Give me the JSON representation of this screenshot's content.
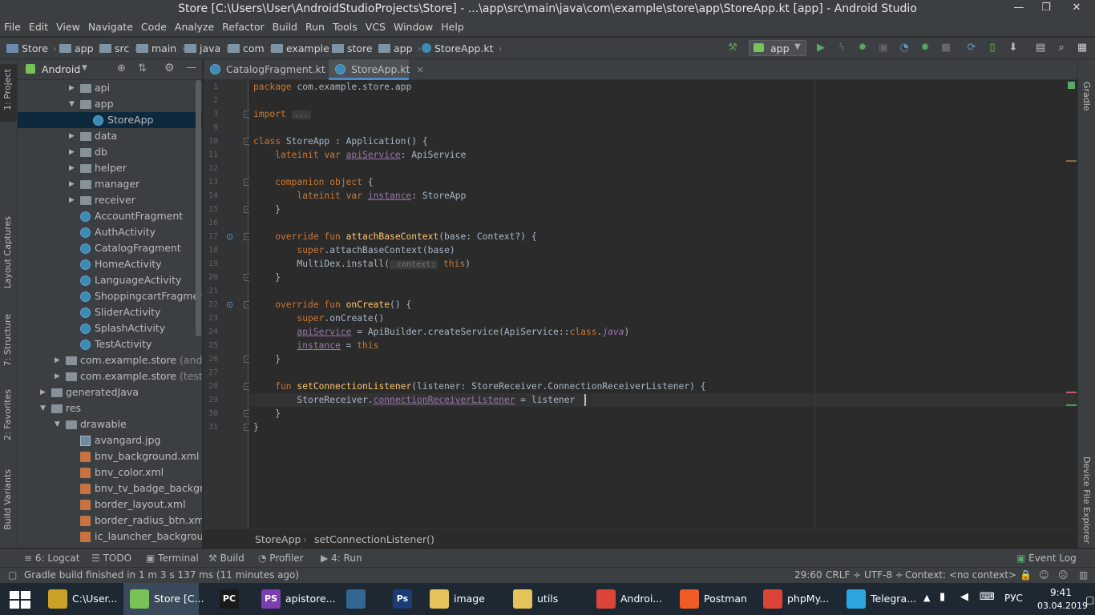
{
  "window": {
    "title": "Store [C:\\Users\\User\\AndroidStudioProjects\\Store] - ...\\app\\src\\main\\java\\com\\example\\store\\app\\StoreApp.kt [app] - Android Studio",
    "minimize": "—",
    "maximize": "❐",
    "close": "✕"
  },
  "menu": [
    "File",
    "Edit",
    "View",
    "Navigate",
    "Code",
    "Analyze",
    "Refactor",
    "Build",
    "Run",
    "Tools",
    "VCS",
    "Window",
    "Help"
  ],
  "breadcrumb": [
    "Store",
    "app",
    "src",
    "main",
    "java",
    "com",
    "example",
    "store",
    "app",
    "StoreApp.kt"
  ],
  "toolbar": {
    "run_config": "app"
  },
  "left_tool_windows": [
    "1: Project",
    "Layout Captures",
    "7: Structure",
    "2: Favorites",
    "Build Variants"
  ],
  "right_tool_windows": [
    "Gradle",
    "Device File Explorer"
  ],
  "project_panel": {
    "view": "Android",
    "rows": [
      {
        "label": "api",
        "type": "folder",
        "level": 3,
        "arrow": "right"
      },
      {
        "label": "app",
        "type": "folder",
        "level": 3,
        "arrow": "down"
      },
      {
        "label": "StoreApp",
        "type": "class",
        "level": 4,
        "selected": true
      },
      {
        "label": "data",
        "type": "folder",
        "level": 3,
        "arrow": "right"
      },
      {
        "label": "db",
        "type": "folder",
        "level": 3,
        "arrow": "right"
      },
      {
        "label": "helper",
        "type": "folder",
        "level": 3,
        "arrow": "right"
      },
      {
        "label": "manager",
        "type": "folder",
        "level": 3,
        "arrow": "right"
      },
      {
        "label": "receiver",
        "type": "folder",
        "level": 3,
        "arrow": "right"
      },
      {
        "label": "AccountFragment",
        "type": "class",
        "level": 3
      },
      {
        "label": "AuthActivity",
        "type": "class",
        "level": 3
      },
      {
        "label": "CatalogFragment",
        "type": "class",
        "level": 3
      },
      {
        "label": "HomeActivity",
        "type": "class",
        "level": 3
      },
      {
        "label": "LanguageActivity",
        "type": "class",
        "level": 3
      },
      {
        "label": "ShoppingcartFragment",
        "type": "class",
        "level": 3
      },
      {
        "label": "SliderActivity",
        "type": "class",
        "level": 3
      },
      {
        "label": "SplashActivity",
        "type": "class",
        "level": 3
      },
      {
        "label": "TestActivity",
        "type": "class",
        "level": 3
      },
      {
        "label": "com.example.store",
        "suffix": "(androidT",
        "type": "folder",
        "level": 2,
        "arrow": "right"
      },
      {
        "label": "com.example.store",
        "suffix": "(test)",
        "type": "folder",
        "level": 2,
        "arrow": "right"
      },
      {
        "label": "generatedJava",
        "type": "folder",
        "level": 1,
        "arrow": "right"
      },
      {
        "label": "res",
        "type": "folder",
        "level": 1,
        "arrow": "down"
      },
      {
        "label": "drawable",
        "type": "folder",
        "level": 2,
        "arrow": "down"
      },
      {
        "label": "avangard.jpg",
        "type": "img",
        "level": 3
      },
      {
        "label": "bnv_background.xml",
        "type": "xml",
        "level": 3
      },
      {
        "label": "bnv_color.xml",
        "type": "xml",
        "level": 3
      },
      {
        "label": "bnv_tv_badge_background",
        "type": "xml",
        "level": 3
      },
      {
        "label": "border_layout.xml",
        "type": "xml",
        "level": 3
      },
      {
        "label": "border_radius_btn.xml",
        "type": "xml",
        "level": 3
      },
      {
        "label": "ic_launcher_background.x",
        "type": "xml",
        "level": 3
      }
    ]
  },
  "editor_tabs": [
    {
      "label": "CatalogFragment.kt",
      "active": false,
      "close": "✕"
    },
    {
      "label": "StoreApp.kt",
      "active": true,
      "close": "✕"
    }
  ],
  "code": {
    "line_numbers": [
      "1",
      "2",
      "3",
      "9",
      "10",
      "11",
      "12",
      "13",
      "14",
      "15",
      "16",
      "17",
      "18",
      "19",
      "20",
      "21",
      "22",
      "23",
      "24",
      "25",
      "26",
      "27",
      "28",
      "29",
      "30",
      "31"
    ],
    "lines": [
      [
        {
          "t": "package ",
          "c": "kw"
        },
        {
          "t": "com.example.store.app",
          "c": ""
        }
      ],
      [],
      [
        {
          "t": "import ",
          "c": "kw"
        },
        {
          "t": "...",
          "c": "hint"
        }
      ],
      [],
      [
        {
          "t": "class ",
          "c": "kw"
        },
        {
          "t": "StoreApp : Application() {",
          "c": ""
        }
      ],
      [
        {
          "t": "    lateinit var ",
          "c": "kw"
        },
        {
          "t": "apiService",
          "c": "pr"
        },
        {
          "t": ": ApiService",
          "c": ""
        }
      ],
      [],
      [
        {
          "t": "    companion object ",
          "c": "kw"
        },
        {
          "t": "{",
          "c": ""
        }
      ],
      [
        {
          "t": "        lateinit var ",
          "c": "kw"
        },
        {
          "t": "instance",
          "c": "pr"
        },
        {
          "t": ": StoreApp",
          "c": ""
        }
      ],
      [
        {
          "t": "    }",
          "c": ""
        }
      ],
      [],
      [
        {
          "t": "    override fun ",
          "c": "kw"
        },
        {
          "t": "attachBaseContext",
          "c": "fn"
        },
        {
          "t": "(base: Context?) {",
          "c": ""
        }
      ],
      [
        {
          "t": "        ",
          "c": ""
        },
        {
          "t": "super",
          "c": "kw"
        },
        {
          "t": ".attachBaseContext(base)",
          "c": ""
        }
      ],
      [
        {
          "t": "        MultiDex.install(",
          "c": ""
        },
        {
          "t": " context:",
          "c": "hint"
        },
        {
          "t": " ",
          "c": ""
        },
        {
          "t": "this",
          "c": "kw"
        },
        {
          "t": ")",
          "c": ""
        }
      ],
      [
        {
          "t": "    }",
          "c": ""
        }
      ],
      [],
      [
        {
          "t": "    override fun ",
          "c": "kw"
        },
        {
          "t": "onCreate",
          "c": "fn"
        },
        {
          "t": "() {",
          "c": ""
        }
      ],
      [
        {
          "t": "        ",
          "c": ""
        },
        {
          "t": "super",
          "c": "kw"
        },
        {
          "t": ".onCreate()",
          "c": ""
        }
      ],
      [
        {
          "t": "        ",
          "c": ""
        },
        {
          "t": "apiService",
          "c": "pr"
        },
        {
          "t": " = ApiBuilder.createService(ApiService::",
          "c": ""
        },
        {
          "t": "class",
          "c": "kw"
        },
        {
          "t": ".",
          "c": ""
        },
        {
          "t": "java",
          "c": "it"
        },
        {
          "t": ")",
          "c": ""
        }
      ],
      [
        {
          "t": "        ",
          "c": ""
        },
        {
          "t": "instance",
          "c": "pr"
        },
        {
          "t": " = ",
          "c": ""
        },
        {
          "t": "this",
          "c": "kw"
        }
      ],
      [
        {
          "t": "    }",
          "c": ""
        }
      ],
      [],
      [
        {
          "t": "    fun ",
          "c": "kw"
        },
        {
          "t": "setConnectionListener",
          "c": "fn"
        },
        {
          "t": "(listener: StoreReceiver.ConnectionReceiverListener) {",
          "c": ""
        }
      ],
      [
        {
          "t": "        StoreReceiver.",
          "c": ""
        },
        {
          "t": "connectionReceiverListener",
          "c": "pr"
        },
        {
          "t": " = listener",
          "c": ""
        }
      ],
      [
        {
          "t": "    }",
          "c": ""
        }
      ],
      [
        {
          "t": "}",
          "c": ""
        }
      ]
    ]
  },
  "editor_breadcrumbs": [
    "StoreApp",
    "setConnectionListener()"
  ],
  "bottom_tools": [
    "6: Logcat",
    "TODO",
    "Terminal",
    "Build",
    "Profiler",
    "4: Run",
    "Event Log"
  ],
  "status": {
    "message": "Gradle build finished in 1 m 3 s 137 ms (11 minutes ago)",
    "position": "29:60",
    "line_sep": "CRLF ÷",
    "encoding": "UTF-8 ÷",
    "context": "Context: <no context>"
  },
  "taskbar": {
    "items": [
      {
        "label": "C:\\User...",
        "color": "#c9a227"
      },
      {
        "label": "Store [C...",
        "color": "#78c257",
        "active": true
      },
      {
        "label": "",
        "color": "#1a1a1a",
        "badge": "PC"
      },
      {
        "label": "apistore...",
        "color": "#7b3fb0",
        "badge": "PS"
      },
      {
        "label": "",
        "color": "#336791"
      },
      {
        "label": "",
        "color": "#1c3c78",
        "badge": "Ps"
      },
      {
        "label": "image",
        "color": "#e3c35a"
      },
      {
        "label": "utils",
        "color": "#e3c35a"
      },
      {
        "label": "Androi...",
        "color": "#db4437"
      },
      {
        "label": "Postman",
        "color": "#ef5b25"
      },
      {
        "label": "phpMy...",
        "color": "#db4437"
      },
      {
        "label": "Telegra...",
        "color": "#2ca5e0"
      }
    ],
    "lang": "РУС",
    "time": "9:41",
    "date": "03.04.2019"
  }
}
